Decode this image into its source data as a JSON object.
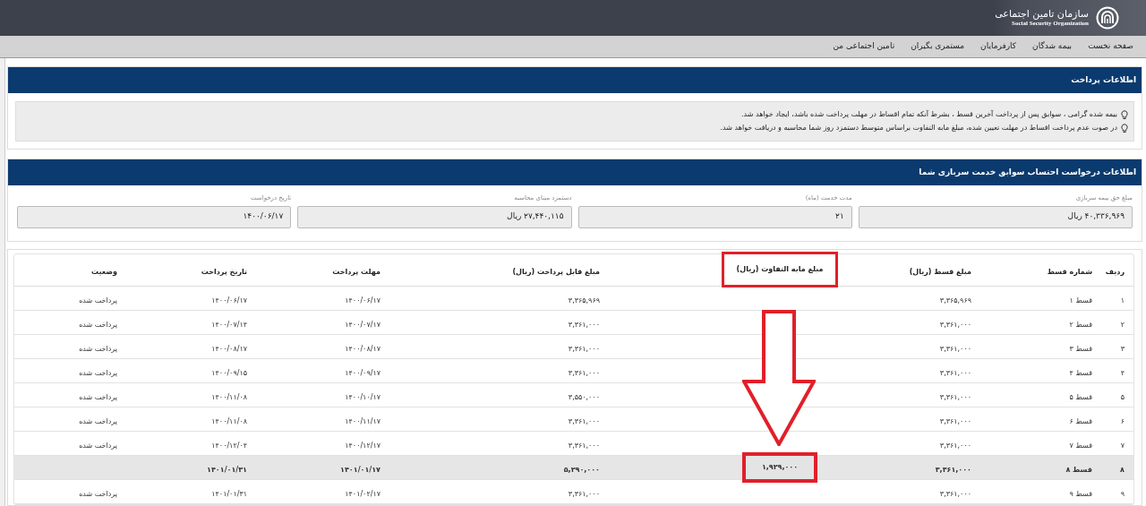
{
  "header": {
    "logo_title": "سازمان تامین اجتماعی",
    "logo_subtitle": "Social Security Organization"
  },
  "nav": [
    "صفحه نخست",
    "بیمه شدگان",
    "کارفرمایان",
    "مستمری بگیران",
    "تامین اجتماعی من"
  ],
  "payment_info": {
    "title": "اطلاعات پرداخت",
    "notes": [
      "بیمه شده گرامی ، سوابق پس از پرداخت آخرین قسط ، بشرط آنکه تمام اقساط در مهلت پرداخت شده باشد، ایجاد خواهد شد.",
      "در صوت عدم پرداخت اقساط در مهلت تعیین شده، مبلغ مابه التفاوت براساس متوسط دستمزد روز شما محاسبه و دریافت خواهد شد."
    ]
  },
  "request_info": {
    "title": "اطلاعات درخواست احتساب سوابق خدمت سربازی شما",
    "fields": [
      {
        "label": "مبلغ حق بیمه سربازی",
        "value": "۴۰,۳۳۶,۹۶۹ ریال"
      },
      {
        "label": "مدت خدمت (ماه)",
        "value": "۲۱"
      },
      {
        "label": "دستمزد مبنای محاسبه",
        "value": "۲۷,۴۴۰,۱۱۵ ریال"
      },
      {
        "label": "تاریخ درخواست",
        "value": "۱۴۰۰/۰۶/۱۷"
      }
    ]
  },
  "table": {
    "columns": [
      {
        "label": "ردیف",
        "marked": false
      },
      {
        "label": "شماره قسط",
        "marked": false
      },
      {
        "label": "مبلغ قسط (ریال)",
        "marked": false
      },
      {
        "label": "مبلغ مابه التفاوت (ریال)",
        "marked": true
      },
      {
        "label": "مبلغ قابل پرداخت (ریال)",
        "marked": false
      },
      {
        "label": "مهلت پرداخت",
        "marked": false
      },
      {
        "label": "تاریخ پرداخت",
        "marked": false
      },
      {
        "label": "وضعیت",
        "marked": false
      }
    ],
    "arrow": true,
    "rows": [
      {
        "selected": false,
        "marked": false,
        "cells": [
          "۱",
          "قسط ۱",
          "۳,۳۶۵,۹۶۹",
          null,
          "۳,۳۶۵,۹۶۹",
          "۱۴۰۰/۰۶/۱۷",
          "۱۴۰۰/۰۶/۱۷",
          "پرداخت شده"
        ]
      },
      {
        "selected": false,
        "marked": false,
        "cells": [
          "۲",
          "قسط ۲",
          "۳,۳۶۱,۰۰۰",
          null,
          "۳,۳۶۱,۰۰۰",
          "۱۴۰۰/۰۷/۱۷",
          "۱۴۰۰/۰۷/۱۴",
          "پرداخت شده"
        ]
      },
      {
        "selected": false,
        "marked": false,
        "cells": [
          "۳",
          "قسط ۳",
          "۳,۳۶۱,۰۰۰",
          null,
          "۳,۳۶۱,۰۰۰",
          "۱۴۰۰/۰۸/۱۷",
          "۱۴۰۰/۰۸/۱۷",
          "پرداخت شده"
        ]
      },
      {
        "selected": false,
        "marked": false,
        "cells": [
          "۴",
          "قسط ۴",
          "۳,۳۶۱,۰۰۰",
          null,
          "۳,۳۶۱,۰۰۰",
          "۱۴۰۰/۰۹/۱۷",
          "۱۴۰۰/۰۹/۱۵",
          "پرداخت شده"
        ]
      },
      {
        "selected": false,
        "marked": false,
        "cells": [
          "۵",
          "قسط ۵",
          "۳,۳۶۱,۰۰۰",
          null,
          "۳,۵۵۰,۰۰۰",
          "۱۴۰۰/۱۰/۱۷",
          "۱۴۰۰/۱۱/۰۸",
          "پرداخت شده"
        ]
      },
      {
        "selected": false,
        "marked": false,
        "cells": [
          "۶",
          "قسط ۶",
          "۳,۳۶۱,۰۰۰",
          null,
          "۳,۳۶۱,۰۰۰",
          "۱۴۰۰/۱۱/۱۷",
          "۱۴۰۰/۱۱/۰۸",
          "پرداخت شده"
        ]
      },
      {
        "selected": false,
        "marked": false,
        "cells": [
          "۷",
          "قسط ۷",
          "۳,۳۶۱,۰۰۰",
          null,
          "۳,۳۶۱,۰۰۰",
          "۱۴۰۰/۱۲/۱۷",
          "۱۴۰۰/۱۲/۰۴",
          "پرداخت شده"
        ]
      },
      {
        "selected": true,
        "marked": true,
        "cells": [
          "۸",
          "قسط ۸",
          "۳,۳۶۱,۰۰۰",
          "۱,۹۲۹,۰۰۰",
          "۵,۲۹۰,۰۰۰",
          "۱۴۰۱/۰۱/۱۷",
          "۱۴۰۱/۰۱/۳۱",
          null
        ]
      },
      {
        "selected": false,
        "marked": false,
        "cells": [
          "۹",
          "قسط ۹",
          "۳,۳۶۱,۰۰۰",
          null,
          "۳,۳۶۱,۰۰۰",
          "۱۴۰۱/۰۲/۱۷",
          "۱۴۰۱/۰۱/۳۱",
          "پرداخت شده"
        ]
      }
    ]
  }
}
